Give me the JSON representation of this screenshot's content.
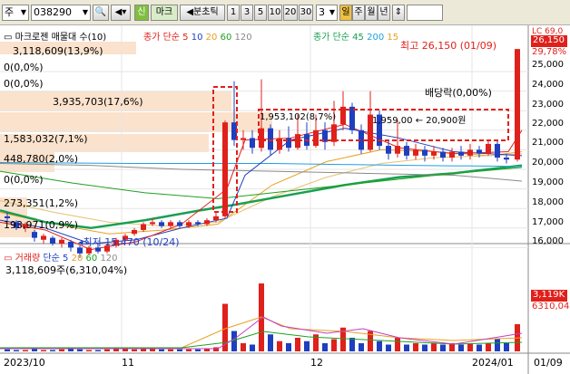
{
  "toolbar": {
    "market": "주",
    "code": "038290",
    "tab_new": "신",
    "tab_name": "마크",
    "interval_label": "분초틱",
    "intervals": [
      "1",
      "3",
      "5",
      "10",
      "20",
      "30"
    ],
    "count": "3",
    "unit_day": "일",
    "unit_week": "주",
    "unit_month": "월",
    "unit_year": "년"
  },
  "price_panel": {
    "title": "마크로젠 매물대 수(10)",
    "ma_legend": {
      "prefix": "종가 단순",
      "periods": [
        "5",
        "10",
        "20",
        "60",
        "120"
      ]
    },
    "ma2_legend": {
      "prefix": "종가 단순",
      "periods": [
        "45",
        "200",
        "15"
      ]
    },
    "volume_profile_labels": [
      "3,118,609(13,9%)",
      "0(0,0%)",
      "0(0,0%)",
      "3,935,703(17,6%)",
      "1,583,032(7,1%)",
      "448,780(2,0%)",
      "0(0,0%)",
      "273,351(1,2%)",
      "193,971(0,9%)"
    ],
    "box_label": "1,953,102(8,7%)",
    "price_note": "1,959,00 ← 20,900원",
    "high_label": "최고 26,150 (01/09)",
    "low_label": "최저 15,470 (10/24)",
    "dividend_label": "배당락(0,00%)",
    "current_price": "26,150",
    "right_top": "LC 69,0",
    "change_pct": "29,78%",
    "y_ticks": [
      "25,000",
      "24,000",
      "23,000",
      "22,000",
      "21,000",
      "20,000",
      "19,000",
      "18,000",
      "17,000",
      "16,000"
    ]
  },
  "volume_panel": {
    "legend": {
      "title": "거래량",
      "prefix": "단순",
      "periods": [
        "5",
        "20",
        "60",
        "120"
      ]
    },
    "value_label": "3,118,609주(6,310,04%)",
    "right_value": "3,119K",
    "right_value2": "6310,04"
  },
  "x_axis": {
    "labels": [
      "2023/10",
      "11",
      "12",
      "2024/01"
    ],
    "right_date": "01/09"
  },
  "colors": {
    "up": "#e0201b",
    "down": "#1f3fbf",
    "ma5": "#e0201b",
    "ma10": "#1f3fbf",
    "ma20": "#e8a020",
    "ma60": "#20a020",
    "ma120": "#8a8a8a",
    "ma45": "#18a050"
  }
}
